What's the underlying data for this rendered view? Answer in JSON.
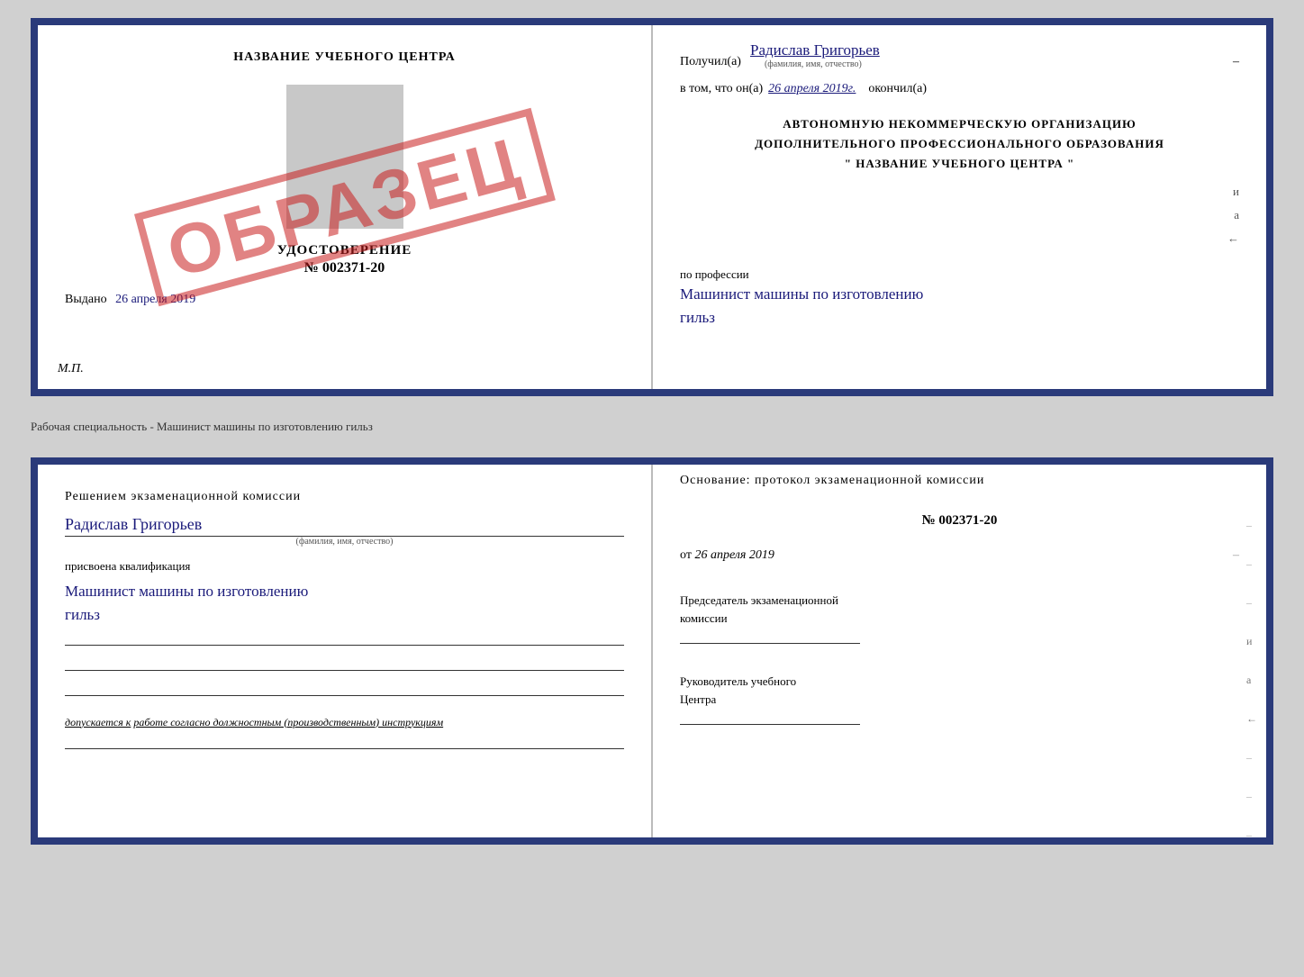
{
  "top_cert": {
    "left": {
      "title": "НАЗВАНИЕ УЧЕБНОГО ЦЕНТРА",
      "udostoverenie_label": "УДОСТОВЕРЕНИЕ",
      "number": "№ 002371-20",
      "vydano": "Выдано",
      "vydano_date": "26 апреля 2019",
      "mp": "М.П.",
      "stamp": "ОБРАЗЕЦ"
    },
    "right": {
      "poluchil": "Получил(а)",
      "name": "Радислав Григорьев",
      "fio_sub": "(фамилия, имя, отчество)",
      "dash": "–",
      "vtom_prefix": "в том, что он(а)",
      "vtom_date": "26 апреля 2019г.",
      "okonchil": "окончил(а)",
      "avt_line1": "АВТОНОМНУЮ НЕКОММЕРЧЕСКУЮ ОРГАНИЗАЦИЮ",
      "avt_line2": "ДОПОЛНИТЕЛЬНОГО ПРОФЕССИОНАЛЬНОГО ОБРАЗОВАНИЯ",
      "avt_line3": "\"   НАЗВАНИЕ УЧЕБНОГО ЦЕНТРА   \"",
      "po_professii": "по профессии",
      "professiya": "Машинист машины по изготовлению",
      "professiya2": "гильз"
    }
  },
  "separator": {
    "text": "Рабочая специальность - Машинист машины по изготовлению гильз"
  },
  "bottom_cert": {
    "left": {
      "resheniem": "Решением  экзаменационной  комиссии",
      "fio": "Радислав Григорьев",
      "fio_sub": "(фамилия, имя, отчество)",
      "prisvoyena": "присвоена квалификация",
      "kval": "Машинист машины по изготовлению",
      "kval2": "гильз",
      "dopuskaetsya_prefix": "допускается к",
      "dopuskaetsya_text": "работе согласно должностным (производственным) инструкциям"
    },
    "right": {
      "osnovaniye": "Основание:  протокол  экзаменационной  комиссии",
      "number": "№  002371-20",
      "ot_prefix": "от",
      "ot_date": "26 апреля 2019",
      "predsedatel_line1": "Председатель экзаменационной",
      "predsedatel_line2": "комиссии",
      "rukovoditel_line1": "Руководитель учебного",
      "rukovoditel_line2": "Центра"
    }
  }
}
